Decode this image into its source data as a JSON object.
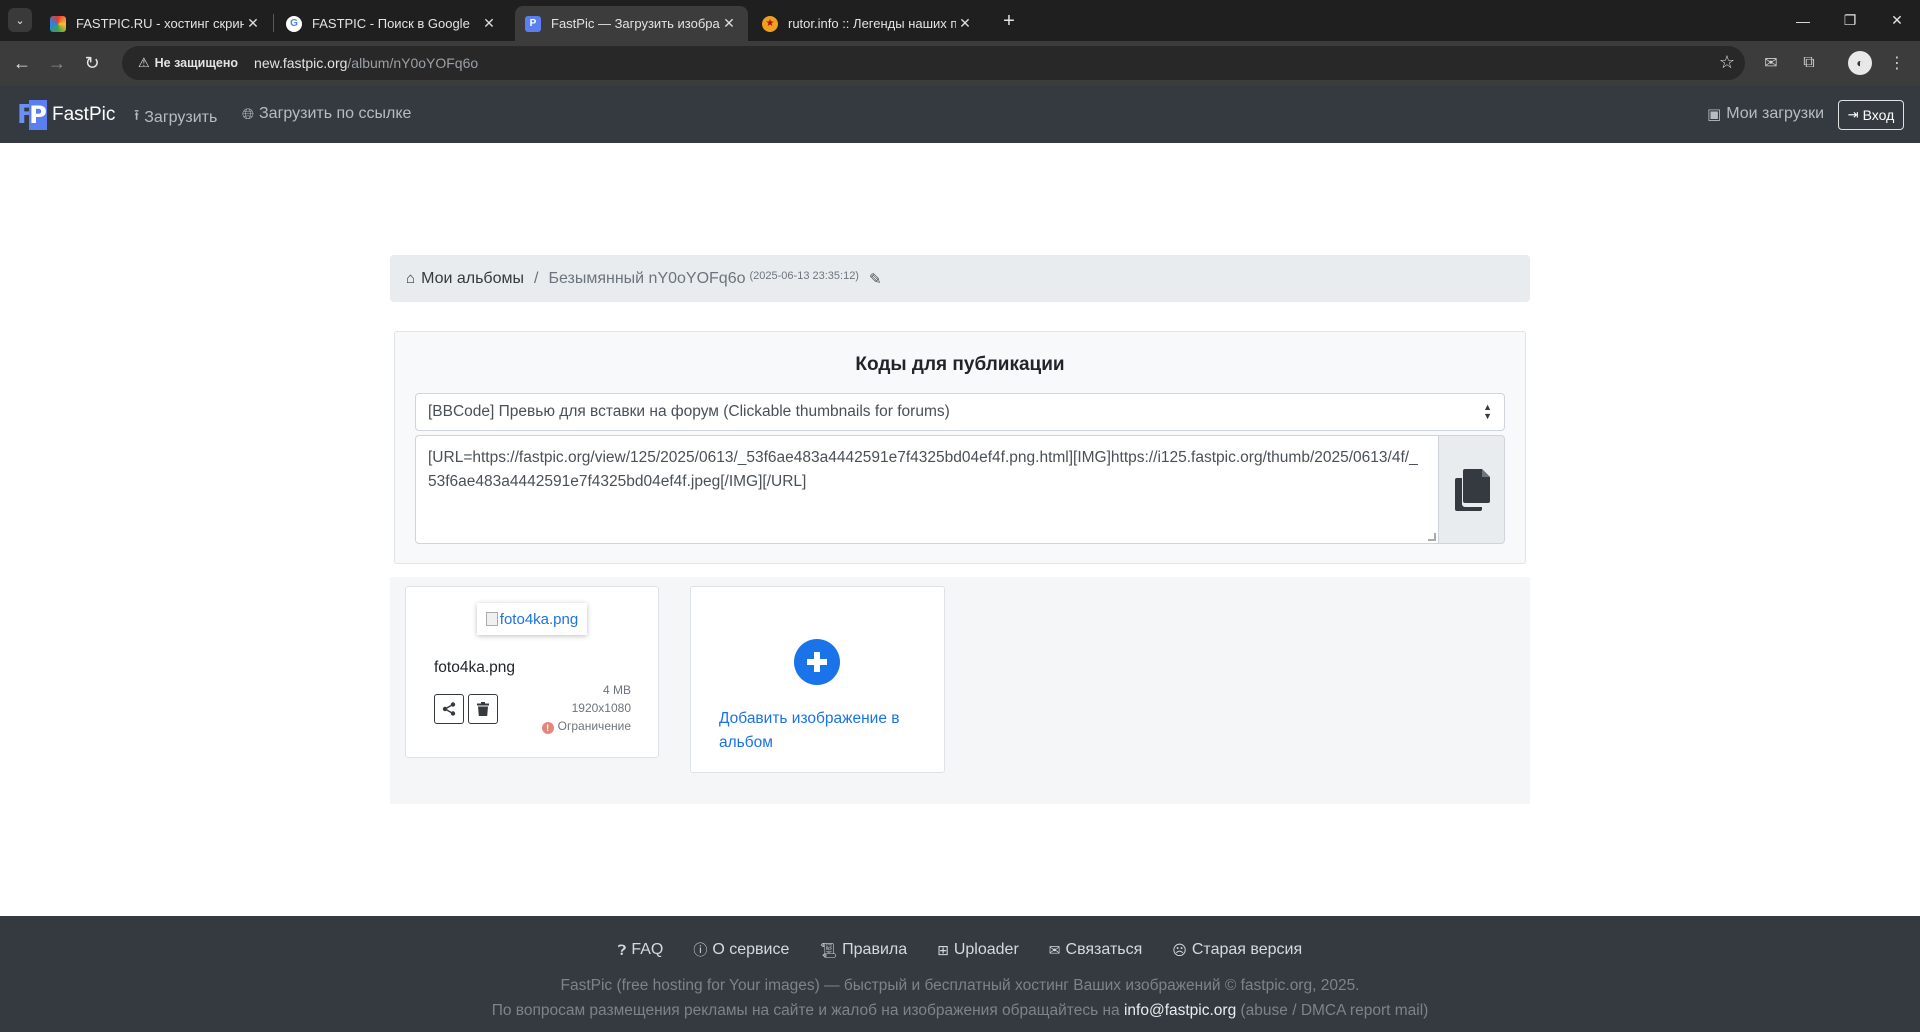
{
  "browser": {
    "tabs": [
      {
        "title": "FASTPIC.RU - хостинг скриншотов",
        "favicon": "fastpic-ru-icon",
        "active": false
      },
      {
        "title": "FASTPIC - Поиск в Google",
        "favicon": "google-icon",
        "active": false
      },
      {
        "title": "FastPic — Загрузить изображение",
        "favicon": "fastpic-icon",
        "active": true
      },
      {
        "title": "rutor.info :: Легенды наших предков",
        "favicon": "rutor-icon",
        "active": false
      }
    ],
    "security_label": "Не защищено",
    "url_host": "new.fastpic.org",
    "url_path": "/album/nY0oYOFq6o"
  },
  "site_nav": {
    "brand": "FastPic",
    "upload": "Загрузить",
    "upload_by_link": "Загрузить по ссылке",
    "my_uploads": "Мои загрузки",
    "login": "Вход"
  },
  "breadcrumb": {
    "home": "Мои альбомы",
    "separator": "/",
    "current": "Безымянный nY0oYOFq6o",
    "date": "(2025-06-13 23:35:12)"
  },
  "codes": {
    "title": "Коды для публикации",
    "selected_format": "[BBCode] Превью для вставки на форум (Clickable thumbnails for forums)",
    "code_text": "[URL=https://fastpic.org/view/125/2025/0613/_53f6ae483a4442591e7f4325bd04ef4f.png.html][IMG]https://i125.fastpic.org/thumb/2025/0613/4f/_53f6ae483a4442591e7f4325bd04ef4f.jpeg[/IMG][/URL]"
  },
  "image": {
    "alt": "foto4ka.png",
    "name": "foto4ka.png",
    "size": "4 MB",
    "dimensions": "1920x1080",
    "restriction": "Ограничение"
  },
  "add_image": {
    "label": "Добавить изображение в альбом"
  },
  "footer": {
    "links": [
      "FAQ",
      "О сервисе",
      "Правила",
      "Uploader",
      "Связаться",
      "Старая версия"
    ],
    "tagline": "FastPic (free hosting for Your images) — быстрый и бесплатный хостинг Ваших изображений © fastpic.org, 2025.",
    "ads_prefix": "По вопросам размещения рекламы на сайте и жалоб на изображения обращайтесь на",
    "email": "info@fastpic.org",
    "ads_suffix": "(abuse / DMCA report mail)"
  },
  "colors": {
    "navbar_bg": "#343a40",
    "link_blue": "#1a73e8",
    "breadcrumb_bg": "#e9ecef",
    "restriction_red": "#e4867c"
  }
}
